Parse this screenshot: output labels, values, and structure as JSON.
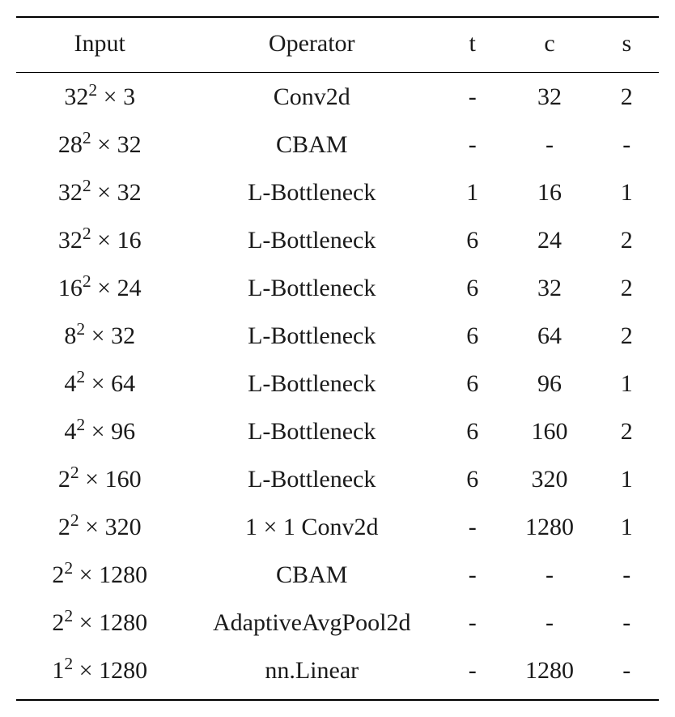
{
  "chart_data": {
    "type": "table",
    "headers": [
      "Input",
      "Operator",
      "t",
      "c",
      "s"
    ],
    "rows": [
      {
        "input": {
          "base": "32",
          "exp": "2",
          "suffix": " × 3"
        },
        "operator": "Conv2d",
        "t": "-",
        "c": "32",
        "s": "2"
      },
      {
        "input": {
          "base": "28",
          "exp": "2",
          "suffix": " × 32"
        },
        "operator": "CBAM",
        "t": "-",
        "c": "-",
        "s": "-"
      },
      {
        "input": {
          "base": "32",
          "exp": "2",
          "suffix": " × 32"
        },
        "operator": "L-Bottleneck",
        "t": "1",
        "c": "16",
        "s": "1"
      },
      {
        "input": {
          "base": "32",
          "exp": "2",
          "suffix": " × 16"
        },
        "operator": "L-Bottleneck",
        "t": "6",
        "c": "24",
        "s": "2"
      },
      {
        "input": {
          "base": "16",
          "exp": "2",
          "suffix": " × 24"
        },
        "operator": "L-Bottleneck",
        "t": "6",
        "c": "32",
        "s": "2"
      },
      {
        "input": {
          "base": "8",
          "exp": "2",
          "suffix": " × 32"
        },
        "operator": "L-Bottleneck",
        "t": "6",
        "c": "64",
        "s": "2"
      },
      {
        "input": {
          "base": "4",
          "exp": "2",
          "suffix": " × 64"
        },
        "operator": "L-Bottleneck",
        "t": "6",
        "c": "96",
        "s": "1"
      },
      {
        "input": {
          "base": "4",
          "exp": "2",
          "suffix": " × 96"
        },
        "operator": "L-Bottleneck",
        "t": "6",
        "c": "160",
        "s": "2"
      },
      {
        "input": {
          "base": "2",
          "exp": "2",
          "suffix": " × 160"
        },
        "operator": "L-Bottleneck",
        "t": "6",
        "c": "320",
        "s": "1"
      },
      {
        "input": {
          "base": "2",
          "exp": "2",
          "suffix": " × 320"
        },
        "operator": "1 × 1 Conv2d",
        "t": "-",
        "c": "1280",
        "s": "1"
      },
      {
        "input": {
          "base": "2",
          "exp": "2",
          "suffix": " × 1280"
        },
        "operator": "CBAM",
        "t": "-",
        "c": "-",
        "s": "-"
      },
      {
        "input": {
          "base": "2",
          "exp": "2",
          "suffix": " × 1280"
        },
        "operator": "AdaptiveAvgPool2d",
        "t": "-",
        "c": "-",
        "s": "-"
      },
      {
        "input": {
          "base": "1",
          "exp": "2",
          "suffix": " × 1280"
        },
        "operator": "nn.Linear",
        "t": "-",
        "c": "1280",
        "s": "-"
      }
    ]
  }
}
